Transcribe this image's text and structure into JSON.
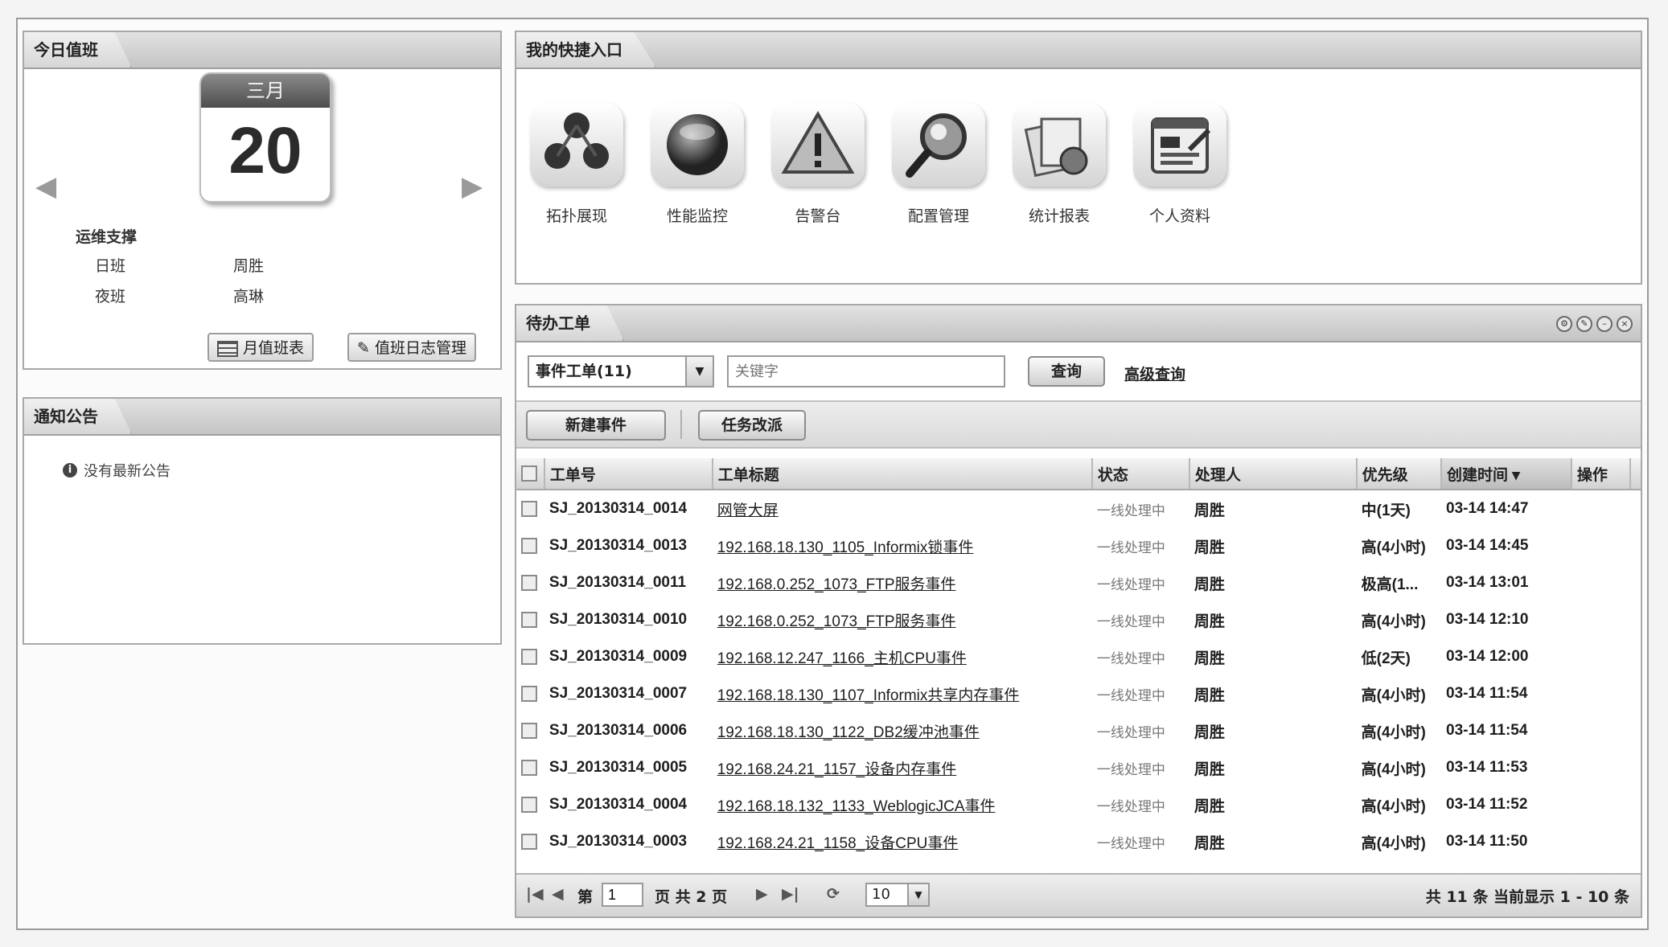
{
  "duty": {
    "title": "今日值班",
    "month": "三月",
    "day": "20",
    "prev": "◀",
    "next": "▶",
    "team": "运维支撑",
    "rows": [
      {
        "shift": "日班",
        "person": "周胜"
      },
      {
        "shift": "夜班",
        "person": "高琳"
      }
    ],
    "btn_monthly": "月值班表",
    "btn_log": "值班日志管理"
  },
  "notice": {
    "title": "通知公告",
    "empty": "没有最新公告"
  },
  "shortcuts": {
    "title": "我的快捷入口",
    "items": [
      {
        "label": "拓扑展现",
        "icon": "topology-icon"
      },
      {
        "label": "性能监控",
        "icon": "performance-icon"
      },
      {
        "label": "告警台",
        "icon": "alarm-icon"
      },
      {
        "label": "配置管理",
        "icon": "config-search-icon"
      },
      {
        "label": "统计报表",
        "icon": "report-icon"
      },
      {
        "label": "个人资料",
        "icon": "profile-icon"
      }
    ]
  },
  "orders": {
    "title": "待办工单",
    "select_value": "事件工单(11)",
    "keyword_placeholder": "关键字",
    "search_btn": "查询",
    "advanced_link": "高级查询",
    "new_btn": "新建事件",
    "task_btn": "任务改派",
    "columns": [
      "工单号",
      "工单标题",
      "状态",
      "处理人",
      "优先级",
      "创建时间 ▾",
      "操作"
    ],
    "rows": [
      {
        "id": "SJ_20130314_0014",
        "title": "网管大屏",
        "status": "一线处理中",
        "handler": "周胜",
        "priority": "中(1天)",
        "created": "03-14 14:47"
      },
      {
        "id": "SJ_20130314_0013",
        "title": "192.168.18.130_1105_Informix锁事件",
        "status": "一线处理中",
        "handler": "周胜",
        "priority": "高(4小时)",
        "created": "03-14 14:45"
      },
      {
        "id": "SJ_20130314_0011",
        "title": "192.168.0.252_1073_FTP服务事件",
        "status": "一线处理中",
        "handler": "周胜",
        "priority": "极高(1...",
        "created": "03-14 13:01"
      },
      {
        "id": "SJ_20130314_0010",
        "title": "192.168.0.252_1073_FTP服务事件",
        "status": "一线处理中",
        "handler": "周胜",
        "priority": "高(4小时)",
        "created": "03-14 12:10"
      },
      {
        "id": "SJ_20130314_0009",
        "title": "192.168.12.247_1166_主机CPU事件",
        "status": "一线处理中",
        "handler": "周胜",
        "priority": "低(2天)",
        "created": "03-14 12:00"
      },
      {
        "id": "SJ_20130314_0007",
        "title": "192.168.18.130_1107_Informix共享内存事件",
        "status": "一线处理中",
        "handler": "周胜",
        "priority": "高(4小时)",
        "created": "03-14 11:54"
      },
      {
        "id": "SJ_20130314_0006",
        "title": "192.168.18.130_1122_DB2缓冲池事件",
        "status": "一线处理中",
        "handler": "周胜",
        "priority": "高(4小时)",
        "created": "03-14 11:54"
      },
      {
        "id": "SJ_20130314_0005",
        "title": "192.168.24.21_1157_设备内存事件",
        "status": "一线处理中",
        "handler": "周胜",
        "priority": "高(4小时)",
        "created": "03-14 11:53"
      },
      {
        "id": "SJ_20130314_0004",
        "title": "192.168.18.132_1133_WeblogicJCA事件",
        "status": "一线处理中",
        "handler": "周胜",
        "priority": "高(4小时)",
        "created": "03-14 11:52"
      },
      {
        "id": "SJ_20130314_0003",
        "title": "192.168.24.21_1158_设备CPU事件",
        "status": "一线处理中",
        "handler": "周胜",
        "priority": "高(4小时)",
        "created": "03-14 11:50"
      }
    ],
    "pager": {
      "first": "|◀",
      "prev": "◀",
      "page_label": "第",
      "page_value": "1",
      "page_total": "页 共 2 页",
      "next": "▶",
      "last": "▶|",
      "refresh": "⟳",
      "page_size": "10",
      "summary": "共 11 条 当前显示 1 - 10 条"
    }
  }
}
